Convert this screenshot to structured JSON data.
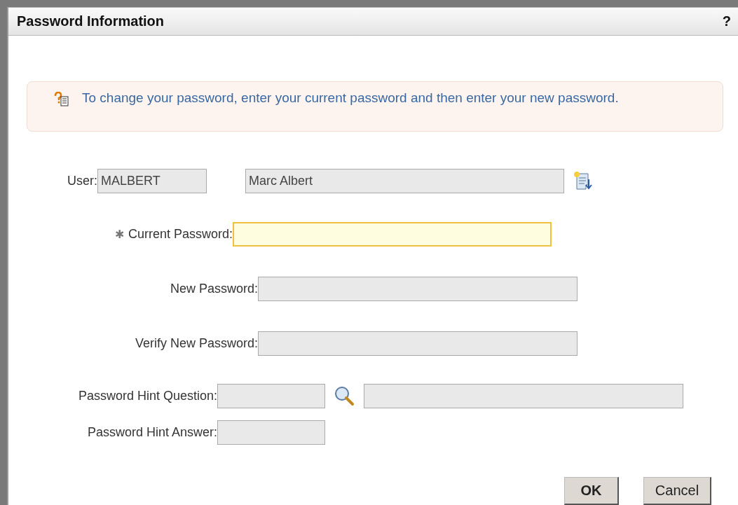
{
  "window": {
    "title": "Password Information",
    "help": "?"
  },
  "message": "To change your password, enter your current password and then enter your new password.",
  "rows": [
    {
      "kind": "user",
      "label": "User:",
      "focused": false,
      "values": [
        "MALBERT",
        "Marc Albert"
      ]
    },
    {
      "kind": "current",
      "required_mark": "✱",
      "label": "Current Password:",
      "focused": true
    },
    {
      "kind": "password",
      "label": "New Password:",
      "focused": false
    },
    {
      "kind": "password",
      "label": "Verify New Password:",
      "focused": false
    },
    {
      "kind": "hint-question",
      "label": "Password Hint Question:",
      "focused": false
    },
    {
      "kind": "hint-answer",
      "label": "Password Hint Answer:",
      "focused": false
    }
  ],
  "buttons": [
    "OK",
    "Cancel"
  ]
}
